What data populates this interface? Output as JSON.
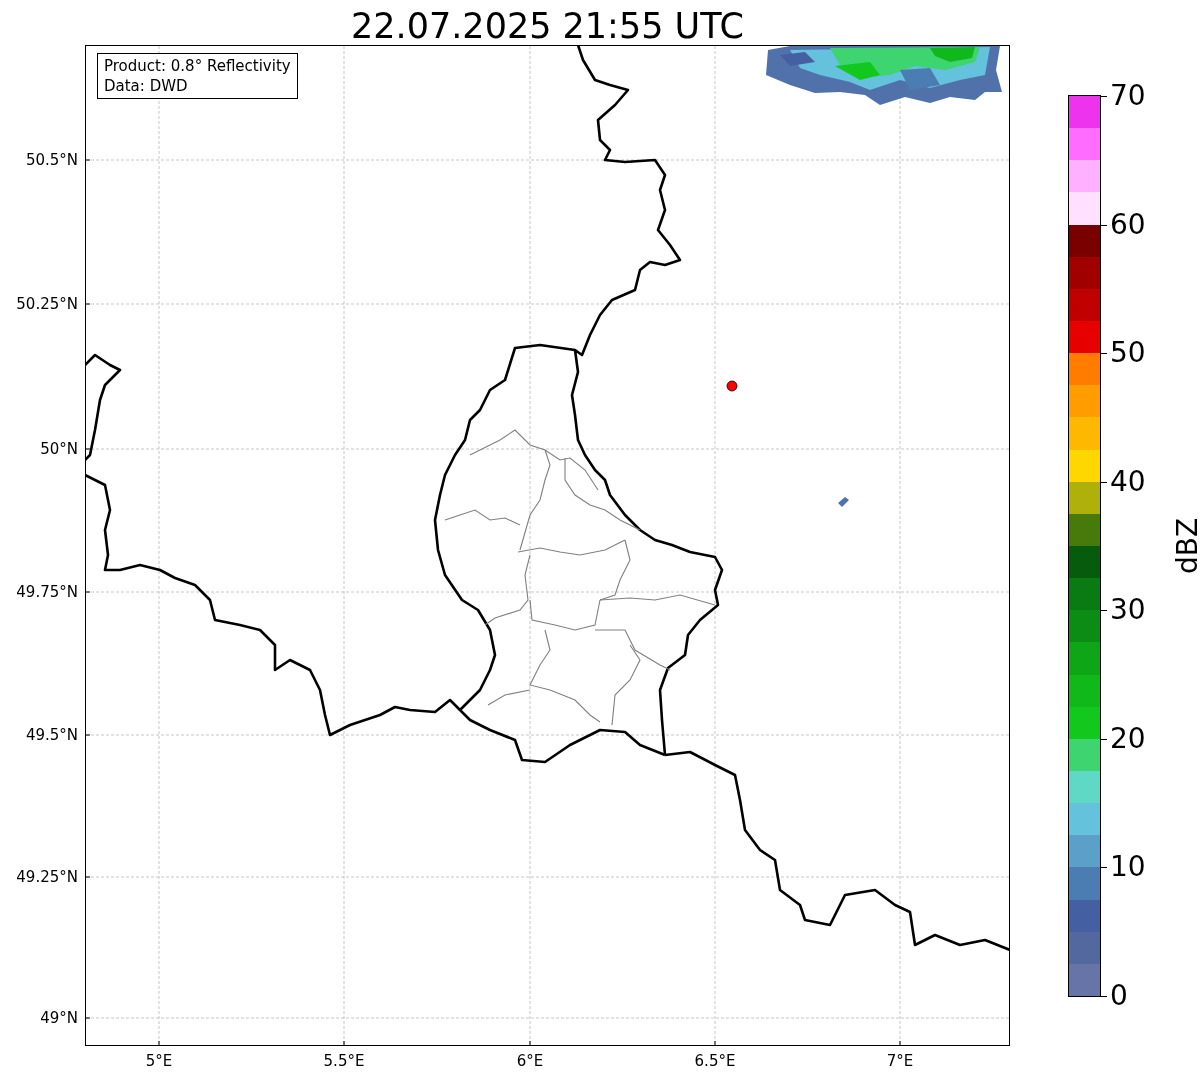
{
  "title": "22.07.2025 21:55 UTC",
  "info_box": [
    "Product: 0.8° Reflectivity",
    "Data: DWD"
  ],
  "map": {
    "x_ticks": [
      "5°E",
      "5.5°E",
      "6°E",
      "6.5°E",
      "7°E"
    ],
    "y_ticks": [
      "50.5°N",
      "50.25°N",
      "50°N",
      "49.75°N",
      "49.5°N",
      "49.25°N",
      "49°N"
    ]
  },
  "colorbar": {
    "label": "dBZ",
    "ticks": [
      "70",
      "60",
      "50",
      "40",
      "30",
      "20",
      "10",
      "0"
    ],
    "bands": [
      {
        "color": "#ee33ee"
      },
      {
        "color": "#ff6cff"
      },
      {
        "color": "#ffb0ff"
      },
      {
        "color": "#ffe0ff"
      },
      {
        "color": "#7a0000"
      },
      {
        "color": "#a00000"
      },
      {
        "color": "#c00000"
      },
      {
        "color": "#e60000"
      },
      {
        "color": "#ff7c00"
      },
      {
        "color": "#ff9c00"
      },
      {
        "color": "#ffb800"
      },
      {
        "color": "#ffd700"
      },
      {
        "color": "#b0b00a"
      },
      {
        "color": "#467a0a"
      },
      {
        "color": "#065c0c"
      },
      {
        "color": "#0a7a12"
      },
      {
        "color": "#0c8c14"
      },
      {
        "color": "#0ea616"
      },
      {
        "color": "#10b81a"
      },
      {
        "color": "#12c81c"
      },
      {
        "color": "#3ed470"
      },
      {
        "color": "#60d8c6"
      },
      {
        "color": "#64c2dc"
      },
      {
        "color": "#5aa0c8"
      },
      {
        "color": "#4c7db2"
      },
      {
        "color": "#4560a2"
      },
      {
        "color": "#5468a0"
      },
      {
        "color": "#6674a8"
      }
    ]
  }
}
